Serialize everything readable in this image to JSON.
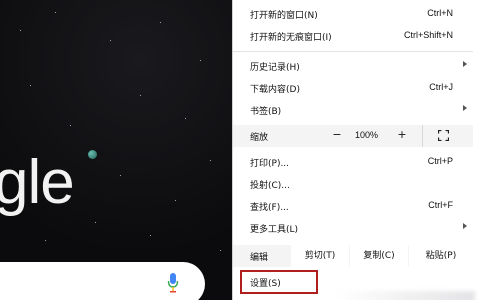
{
  "background": {
    "logo_fragment": "gle"
  },
  "menu": {
    "items": [
      {
        "label": "打开新的窗口(N)",
        "shortcut": "Ctrl+N"
      },
      {
        "label": "打开新的无痕窗口(I)",
        "shortcut": "Ctrl+Shift+N"
      },
      {
        "label": "历史记录(H)",
        "shortcut": ""
      },
      {
        "label": "下载内容(D)",
        "shortcut": "Ctrl+J"
      },
      {
        "label": "书签(B)",
        "shortcut": ""
      },
      {
        "label": "打印(P)...",
        "shortcut": "Ctrl+P"
      },
      {
        "label": "投射(C)...",
        "shortcut": ""
      },
      {
        "label": "查找(F)...",
        "shortcut": "Ctrl+F"
      },
      {
        "label": "更多工具(L)",
        "shortcut": ""
      },
      {
        "label": "设置(S)",
        "shortcut": ""
      }
    ],
    "zoom": {
      "label": "缩放",
      "minus": "−",
      "value": "100%",
      "plus": "+"
    },
    "edit": {
      "label": "编辑",
      "cut": "剪切(T)",
      "copy": "复制(C)",
      "paste": "粘贴(P)"
    }
  },
  "colors": {
    "highlight": "#b01e1e",
    "menu_bg": "#ffffff",
    "page_bg": "#0b0b0d"
  }
}
